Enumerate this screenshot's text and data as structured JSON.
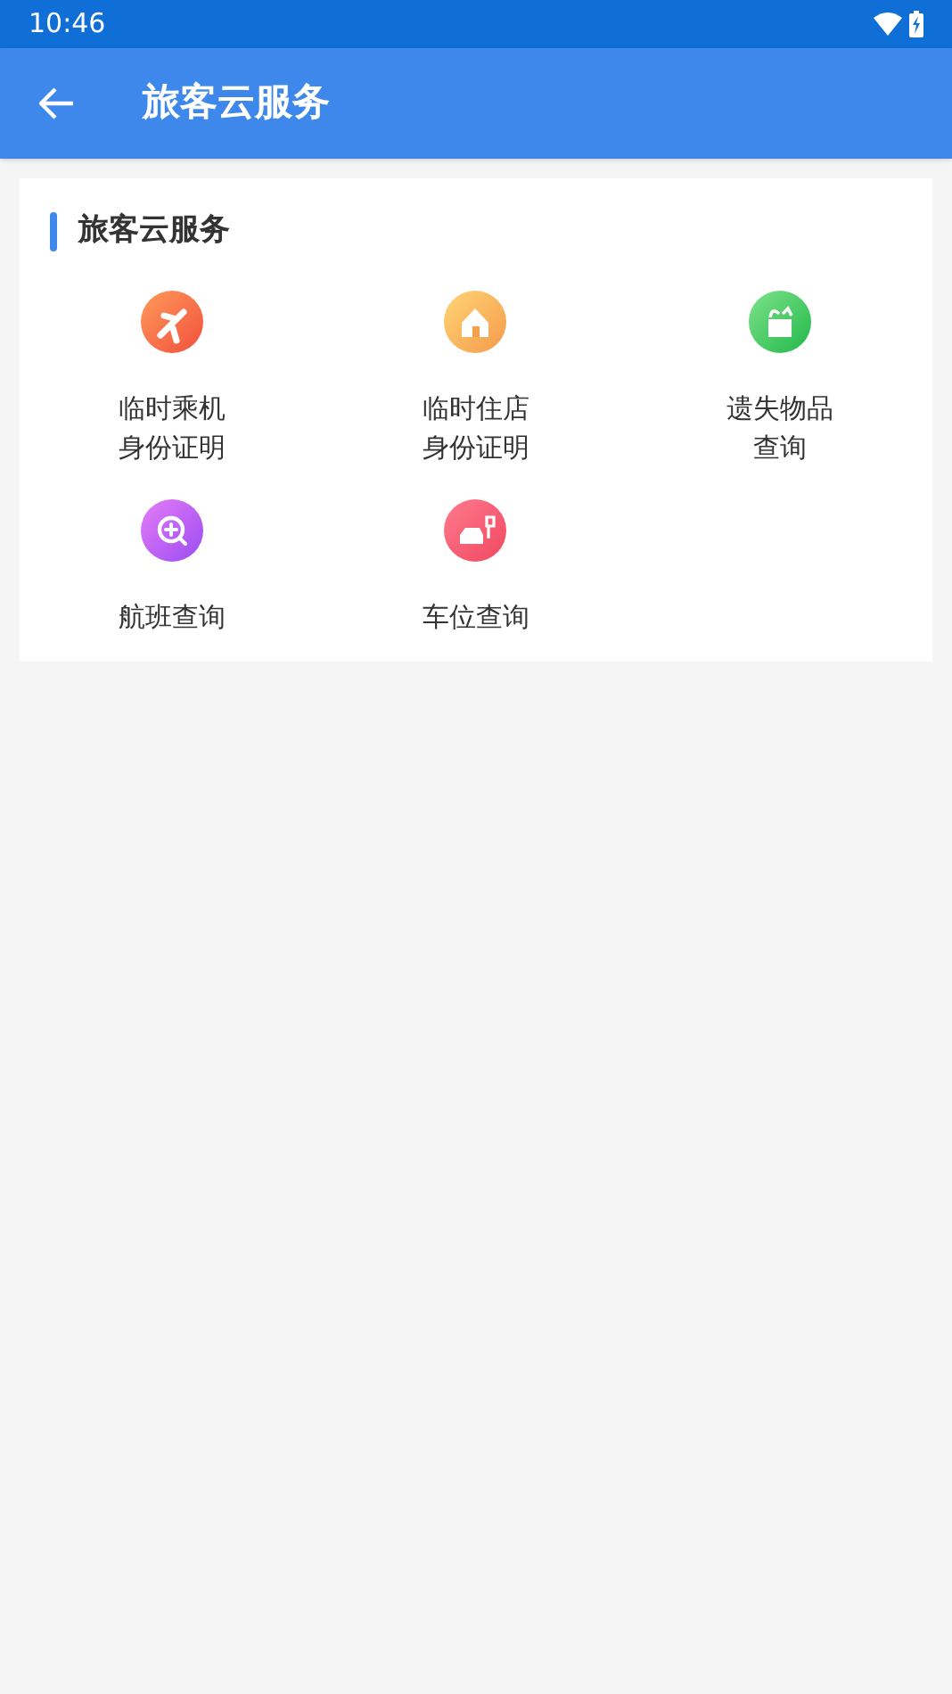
{
  "status_bar": {
    "time": "10:46"
  },
  "app_bar": {
    "title": "旅客云服务"
  },
  "section": {
    "title": "旅客云服务",
    "items": [
      {
        "kind": "plane",
        "lines": [
          "临时乘机",
          "身份证明"
        ]
      },
      {
        "kind": "house",
        "lines": [
          "临时住店",
          "身份证明"
        ]
      },
      {
        "kind": "box",
        "lines": [
          "遗失物品",
          "查询"
        ]
      },
      {
        "kind": "search",
        "lines": [
          "航班查询"
        ]
      },
      {
        "kind": "car",
        "lines": [
          "车位查询"
        ]
      }
    ]
  }
}
